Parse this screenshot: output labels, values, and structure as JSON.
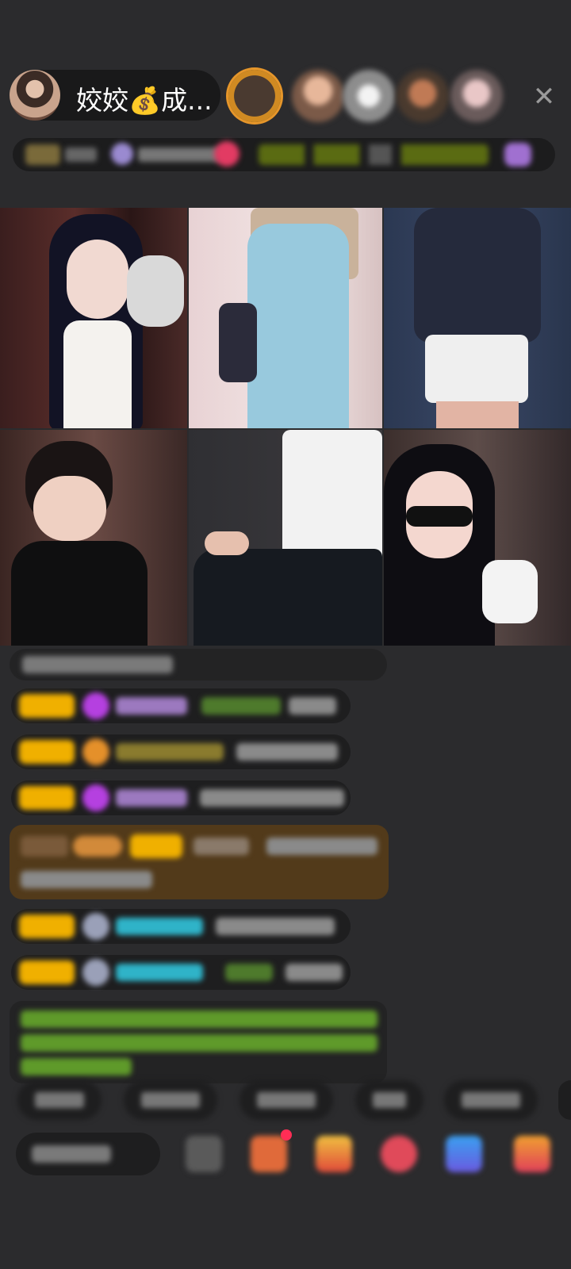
{
  "host": {
    "name": "姣姣💰成..."
  },
  "icons": {
    "close": "close-icon"
  },
  "colors": {
    "background": "#2b2b2d",
    "badge_gold": "#f0b000",
    "gift_brown": "#5a3f1a",
    "chat_green": "#7fcf3a",
    "chat_teal": "#2fb3c8"
  }
}
